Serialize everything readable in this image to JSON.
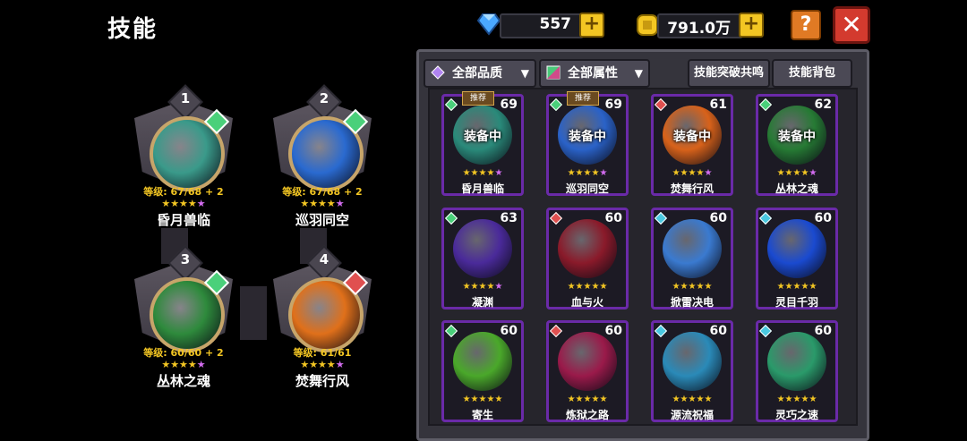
{
  "title": "技能",
  "currency": {
    "diamond": {
      "value": "557",
      "icon": "diamond-icon",
      "color": "#4aa8ff"
    },
    "gold": {
      "value": "791.0万",
      "icon": "gold-coin-icon",
      "color": "#f3c623"
    },
    "plus_label": "+"
  },
  "buttons": {
    "help": "?",
    "close": "✕"
  },
  "equipped": [
    {
      "slot": "1",
      "level": "等级: 67/68 + 2",
      "stars": "★★★★",
      "star_purple": "★",
      "name": "昏月兽临",
      "element": "green",
      "orb": "#3a9a8a"
    },
    {
      "slot": "2",
      "level": "等级: 67/68 + 2",
      "stars": "★★★★",
      "star_purple": "★",
      "name": "巡羽同空",
      "element": "green",
      "orb": "#2a6ad0"
    },
    {
      "slot": "3",
      "level": "等级: 60/60 + 2",
      "stars": "★★★★",
      "star_purple": "★",
      "name": "丛林之魂",
      "element": "green",
      "orb": "#2e8a3c"
    },
    {
      "slot": "4",
      "level": "等级: 61/61",
      "stars": "★★★★",
      "star_purple": "★",
      "name": "焚舞行风",
      "element": "red",
      "orb": "#e0701a"
    }
  ],
  "filters": {
    "quality": "全部品质",
    "attribute": "全部属性",
    "resonance": "技能突破共鸣",
    "backpack": "技能背包"
  },
  "equip_label": "装备中",
  "recommend_label": "推荐",
  "cards": [
    {
      "name": "昏月兽临",
      "level": "69",
      "stars": "★★★★",
      "star_purple": "★",
      "equipped": true,
      "recommended": true,
      "gem": "#4ad07a",
      "art": "#2a8a7a"
    },
    {
      "name": "巡羽同空",
      "level": "69",
      "stars": "★★★★",
      "star_purple": "★",
      "equipped": true,
      "recommended": true,
      "gem": "#4ad07a",
      "art": "#2a62c8"
    },
    {
      "name": "焚舞行风",
      "level": "61",
      "stars": "★★★★",
      "star_purple": "★",
      "equipped": true,
      "recommended": false,
      "gem": "#e05050",
      "art": "#d8621a"
    },
    {
      "name": "丛林之魂",
      "level": "62",
      "stars": "★★★★",
      "star_purple": "★",
      "equipped": true,
      "recommended": false,
      "gem": "#4ad07a",
      "art": "#267a34"
    },
    {
      "name": "凝渊",
      "level": "63",
      "stars": "★★★★",
      "star_purple": "★",
      "equipped": false,
      "recommended": false,
      "gem": "#4ad07a",
      "art": "#4a2a9a"
    },
    {
      "name": "血与火",
      "level": "60",
      "stars": "★★★★★",
      "star_purple": "",
      "equipped": false,
      "recommended": false,
      "gem": "#e05050",
      "art": "#8a1a2a"
    },
    {
      "name": "掀雷决电",
      "level": "60",
      "stars": "★★★★★",
      "star_purple": "",
      "equipped": false,
      "recommended": false,
      "gem": "#4ac8e0",
      "art": "#3a7ad0"
    },
    {
      "name": "灵目千羽",
      "level": "60",
      "stars": "★★★★★",
      "star_purple": "",
      "equipped": false,
      "recommended": false,
      "gem": "#4ac8e0",
      "art": "#1a4ad0"
    },
    {
      "name": "寄生",
      "level": "60",
      "stars": "★★★★★",
      "star_purple": "",
      "equipped": false,
      "recommended": false,
      "gem": "#4ad07a",
      "art": "#4aa82a"
    },
    {
      "name": "炼狱之路",
      "level": "60",
      "stars": "★★★★★",
      "star_purple": "",
      "equipped": false,
      "recommended": false,
      "gem": "#e05050",
      "art": "#9a1a4a"
    },
    {
      "name": "源流祝福",
      "level": "60",
      "stars": "★★★★★",
      "star_purple": "",
      "equipped": false,
      "recommended": false,
      "gem": "#4ac8e0",
      "art": "#2a8ab8"
    },
    {
      "name": "灵巧之速",
      "level": "60",
      "stars": "★★★★★",
      "star_purple": "",
      "equipped": false,
      "recommended": false,
      "gem": "#4ac8e0",
      "art": "#2a9a6a"
    }
  ]
}
